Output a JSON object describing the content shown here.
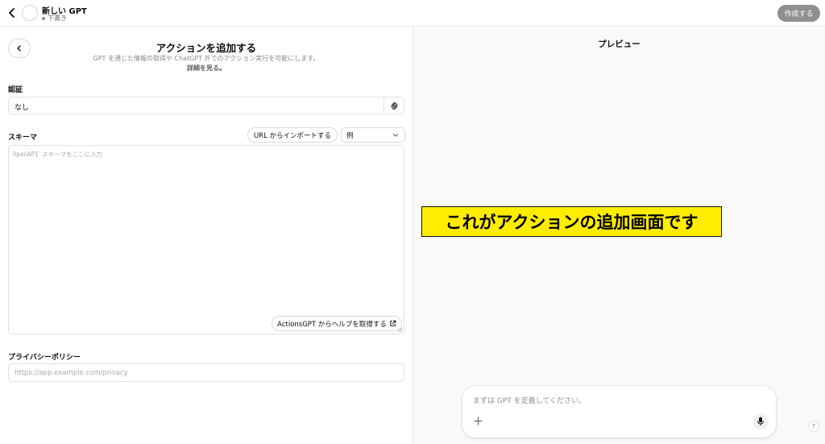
{
  "topbar": {
    "gpt_name": "新しい GPT",
    "status": "下書き",
    "create_label": "作成する"
  },
  "action_panel": {
    "title": "アクションを追加する",
    "description": "GPT を通じた情報の取得や ChatGPT 外でのアクション実行を可能にします。",
    "learn_more": "詳細を見る。"
  },
  "auth": {
    "label": "認証",
    "value": "なし"
  },
  "schema": {
    "label": "スキーマ",
    "import_label": "URL からインポートする",
    "examples_value": "例",
    "placeholder": "OpenAPI スキーマをここに入力",
    "help_label": "ActionsGPT からヘルプを取得する"
  },
  "privacy": {
    "label": "プライバシーポリシー",
    "placeholder": "https://app.example.com/privacy"
  },
  "preview": {
    "title": "プレビュー",
    "annotation": "これがアクションの追加画面です",
    "composer_placeholder": "まずは GPT を定義してください。",
    "help_label": "?"
  },
  "colors": {
    "annotation_bg": "#ffec00",
    "create_button_bg": "#8f8f8f",
    "preview_bg": "#f9f9f9"
  }
}
